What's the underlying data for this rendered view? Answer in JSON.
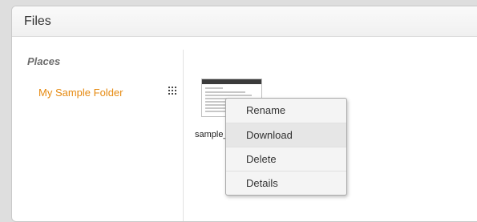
{
  "panel": {
    "title": "Files"
  },
  "sidebar": {
    "heading": "Places",
    "folders": [
      {
        "label": "My Sample Folder",
        "view_icon": "grid-view-icon"
      }
    ]
  },
  "files": [
    {
      "name": "sample_",
      "thumbnail_icon": "document-thumbnail-icon"
    }
  ],
  "context_menu": {
    "items": [
      {
        "label": "Rename"
      },
      {
        "label": "Download"
      },
      {
        "label": "Delete"
      },
      {
        "label": "Details"
      }
    ],
    "highlighted_item": "Download"
  },
  "colors": {
    "accent": "#e68a11",
    "background": "#dedede"
  }
}
